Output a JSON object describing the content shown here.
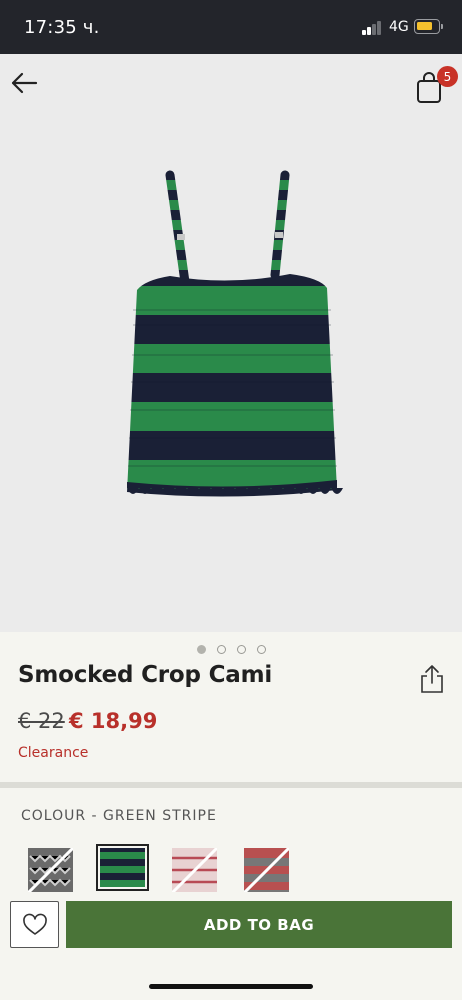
{
  "status_bar": {
    "time": "17:35 ч.",
    "network": "4G"
  },
  "header": {
    "bag_count": "5"
  },
  "gallery": {
    "total_images": 4,
    "active_index": 0
  },
  "product": {
    "name": "Smocked Crop Cami",
    "original_price": "€ 22",
    "sale_price": "€ 18,99",
    "status": "Clearance"
  },
  "colour": {
    "label": "COLOUR - GREEN STRIPE",
    "swatches": [
      {
        "name": "grey-pattern",
        "available": false,
        "selected": false
      },
      {
        "name": "green-stripe",
        "available": true,
        "selected": true
      },
      {
        "name": "pink-pattern",
        "available": false,
        "selected": false
      },
      {
        "name": "red-grey-stripe",
        "available": false,
        "selected": false
      }
    ]
  },
  "actions": {
    "add_to_bag": "ADD TO BAG"
  },
  "colors": {
    "accent_green": "#4a7438",
    "price_red": "#b8302a",
    "badge_red": "#c83227",
    "status_bar_bg": "#23252b"
  }
}
